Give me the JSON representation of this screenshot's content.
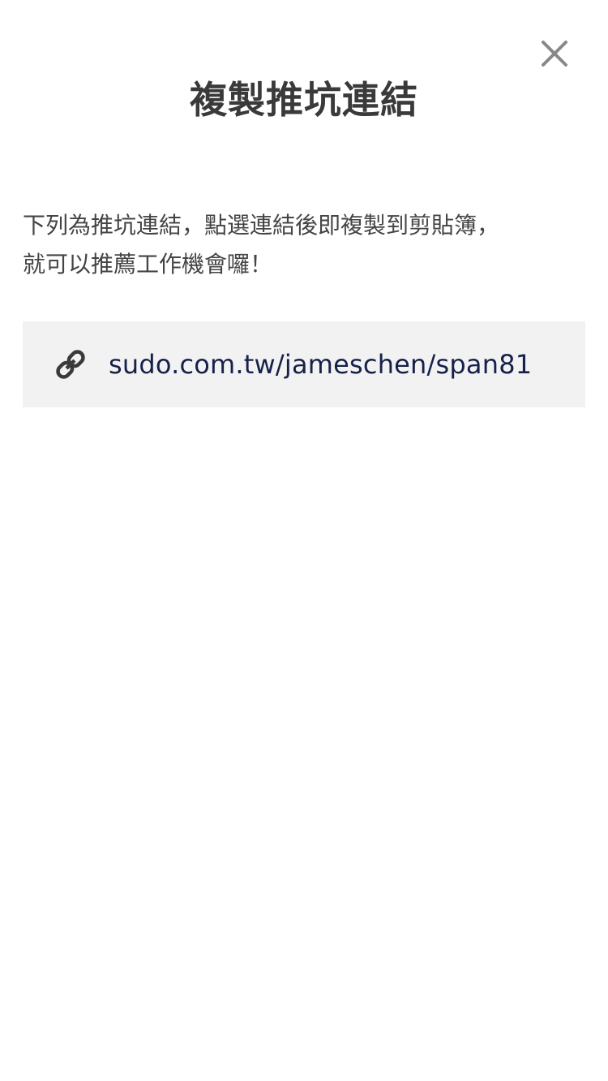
{
  "dialog": {
    "title": "複製推坑連結",
    "description_line1": "下列為推坑連結，點選連結後即複製到剪貼簿，",
    "description_line2": "就可以推薦工作機會囉！",
    "link_url": "sudo.com.tw/jameschen/span81",
    "close_icon": "close-icon",
    "link_icon": "chain-link-icon"
  },
  "colors": {
    "title": "#3a3a3a",
    "body_text": "#444444",
    "link_text": "#16214a",
    "link_box_bg": "#f2f2f2",
    "close_icon": "#888888"
  }
}
